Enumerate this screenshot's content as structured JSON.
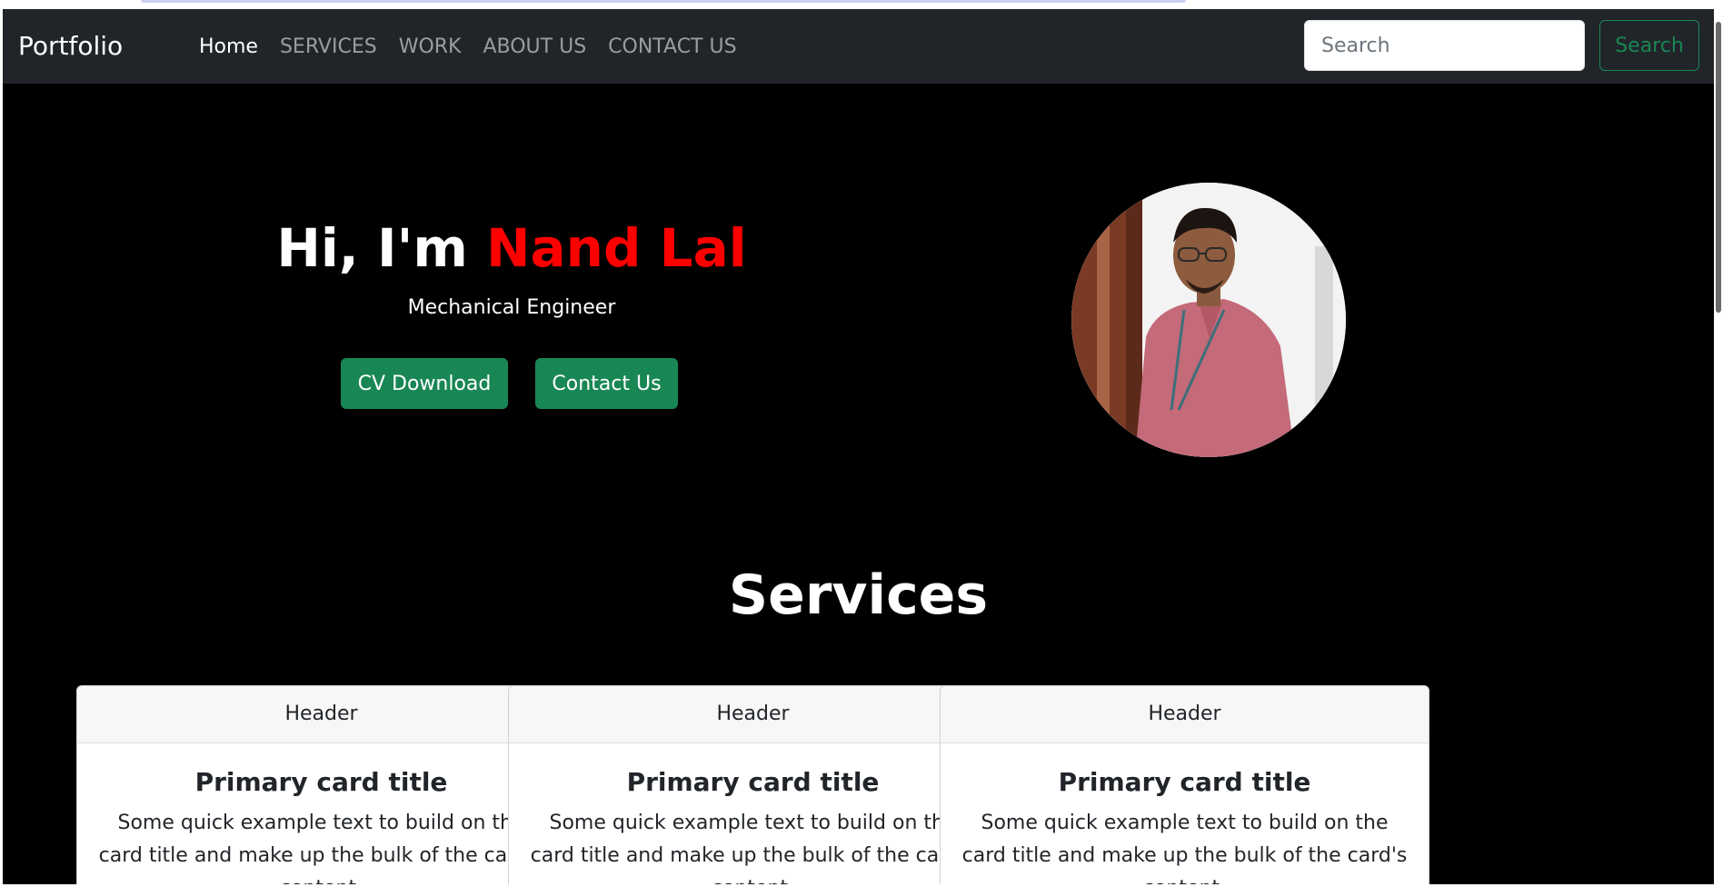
{
  "navbar": {
    "brand": "Portfolio",
    "links": [
      {
        "label": "Home",
        "active": true
      },
      {
        "label": "SERVICES",
        "active": false
      },
      {
        "label": "WORK",
        "active": false
      },
      {
        "label": "ABOUT US",
        "active": false
      },
      {
        "label": "CONTACT US",
        "active": false
      }
    ],
    "search": {
      "placeholder": "Search",
      "value": "",
      "button_label": "Search"
    }
  },
  "hero": {
    "greeting": "Hi, I'm",
    "name": "Nand Lal",
    "subtitle": "Mechanical Engineer",
    "cv_button": "CV Download",
    "contact_button": "Contact Us",
    "avatar_icon": "profile-photo"
  },
  "services": {
    "title": "Services",
    "cards": [
      {
        "header": "Header",
        "title": "Primary card title",
        "text": "Some quick example text to build on the card title and make up the bulk of the card's content."
      },
      {
        "header": "Header",
        "title": "Primary card title",
        "text": "Some quick example text to build on the card title and make up the bulk of the card's content."
      },
      {
        "header": "Header",
        "title": "Primary card title",
        "text": "Some quick example text to build on the card title and make up the bulk of the card's content."
      }
    ]
  },
  "colors": {
    "navbar_bg": "#212529",
    "page_bg": "#000000",
    "accent_green": "#198754",
    "name_red": "#ff0000",
    "nav_link_muted": "rgba(255,255,255,0.55)"
  }
}
